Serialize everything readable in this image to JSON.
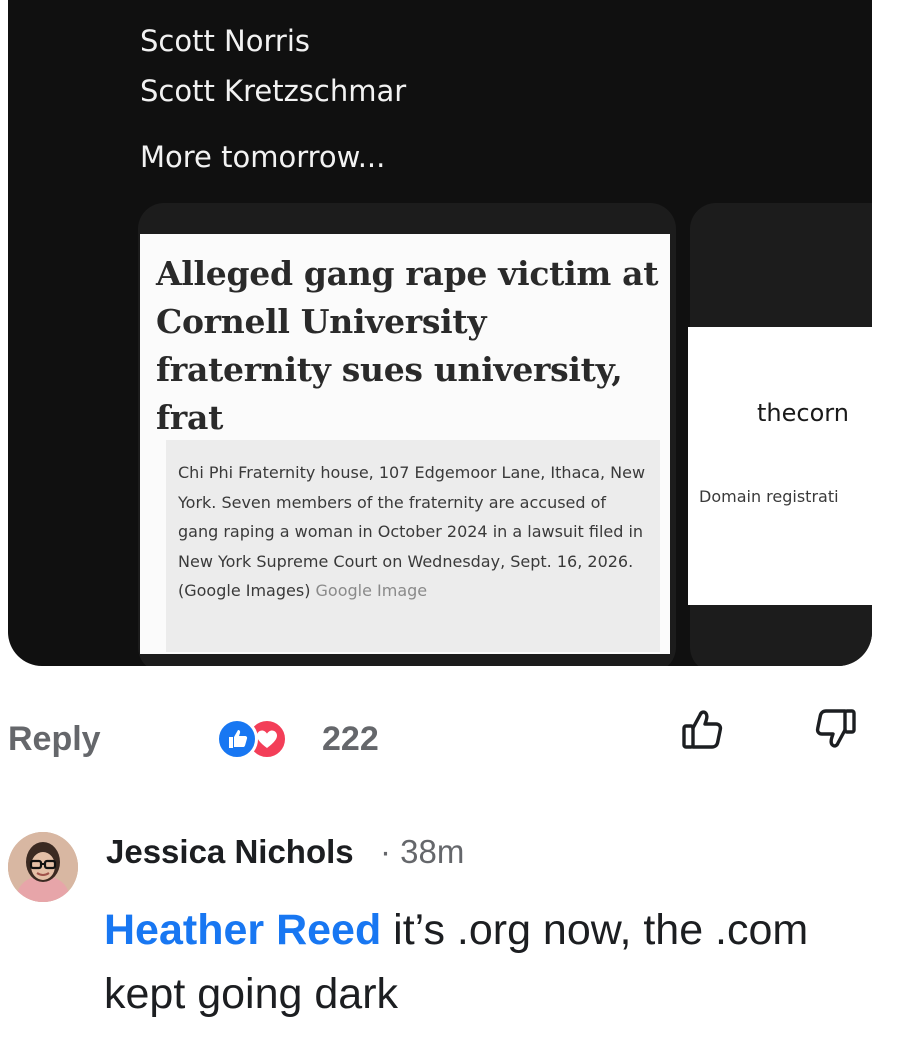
{
  "post": {
    "names": [
      "Scott Norris",
      "Scott Kretzschmar"
    ],
    "more_text": "More tomorrow...",
    "cards": [
      {
        "headline": "Alleged gang rape victim at Cornell University fraternity sues university, frat",
        "caption": "Chi Phi Fraternity house, 107 Edgemoor Lane, Ithaca, New York. Seven members of the fraternity are accused of gang raping a woman in October 2024 in a lawsuit filed in New York Supreme Court on Wednesday, Sept. 16, 2026. (Google Images)",
        "caption_source": "Google Image"
      },
      {
        "domain": "thecorn",
        "subtitle": "Domain registrati"
      }
    ]
  },
  "actions": {
    "reply_label": "Reply",
    "reaction_count": "222",
    "reaction_icons": [
      "like-icon",
      "love-icon"
    ],
    "upvote_icon": "thumbs-up-outline-icon",
    "downvote_icon": "thumbs-down-outline-icon"
  },
  "comment": {
    "author": "Jessica Nichols",
    "time": "· 38m",
    "mention": "Heather Reed",
    "text": " it’s .org now, the .com kept going dark"
  },
  "colors": {
    "link": "#1877f2",
    "muted": "#65676b",
    "card_bg": "#101010",
    "love": "#f33e58"
  }
}
